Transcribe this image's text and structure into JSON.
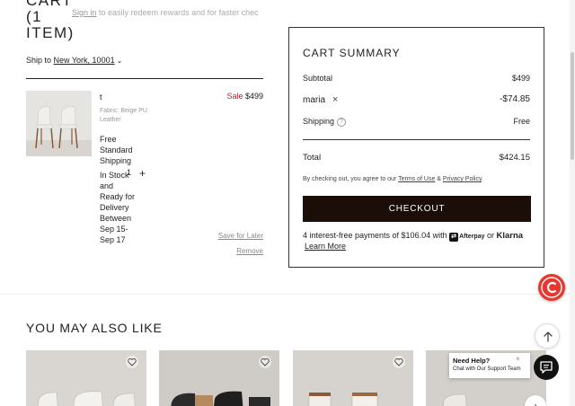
{
  "cart": {
    "title": "CART (1 ITEM)",
    "signin_link": "Sign in",
    "signin_text": " to easily redeem rewards and for faster chec",
    "ship_to_label": "Ship to ",
    "ship_to_location": "New York, 10001",
    "item": {
      "name": "t",
      "fabric": "Fabric: Beige PU Leather",
      "shipping": "Free Standard Shipping",
      "stock": "In Stock and Ready for Delivery Between Sep 15-Sep 17",
      "quantity": "1",
      "sale_label": "Sale",
      "price": "$499",
      "save_for_later": "Save for Later",
      "remove": "Remove"
    }
  },
  "summary": {
    "title": "CART SUMMARY",
    "subtotal_label": "Subtotal",
    "subtotal_value": "$499",
    "promo_code": "maria",
    "promo_value": "-$74.85",
    "shipping_label": "Shipping",
    "shipping_value": "Free",
    "total_label": "Total",
    "total_value": "$424.15",
    "agree_prefix": "By checking out, you agree to our ",
    "terms_link": "Terms of Use",
    "agree_and": " & ",
    "privacy_link": "Privacy Policy",
    "agree_suffix": ".",
    "checkout_label": "CHECKOUT",
    "installments_text": "4 interest-free payments of $106.04 with ",
    "afterpay_label": "Afterpay",
    "or_text": " or ",
    "klarna_label": "Klarna",
    "learn_more": "Learn More"
  },
  "recommendations": {
    "title": "YOU MAY ALSO LIKE"
  },
  "widgets": {
    "help_title": "Need Help?",
    "help_subtitle": "Chat with Our Support Team",
    "close_glyph": "×",
    "next_glyph": "›"
  },
  "colors": {
    "sale": "#b3262b",
    "checkout_bg": "#1b0d08",
    "brand_badge": "#e8372f"
  }
}
